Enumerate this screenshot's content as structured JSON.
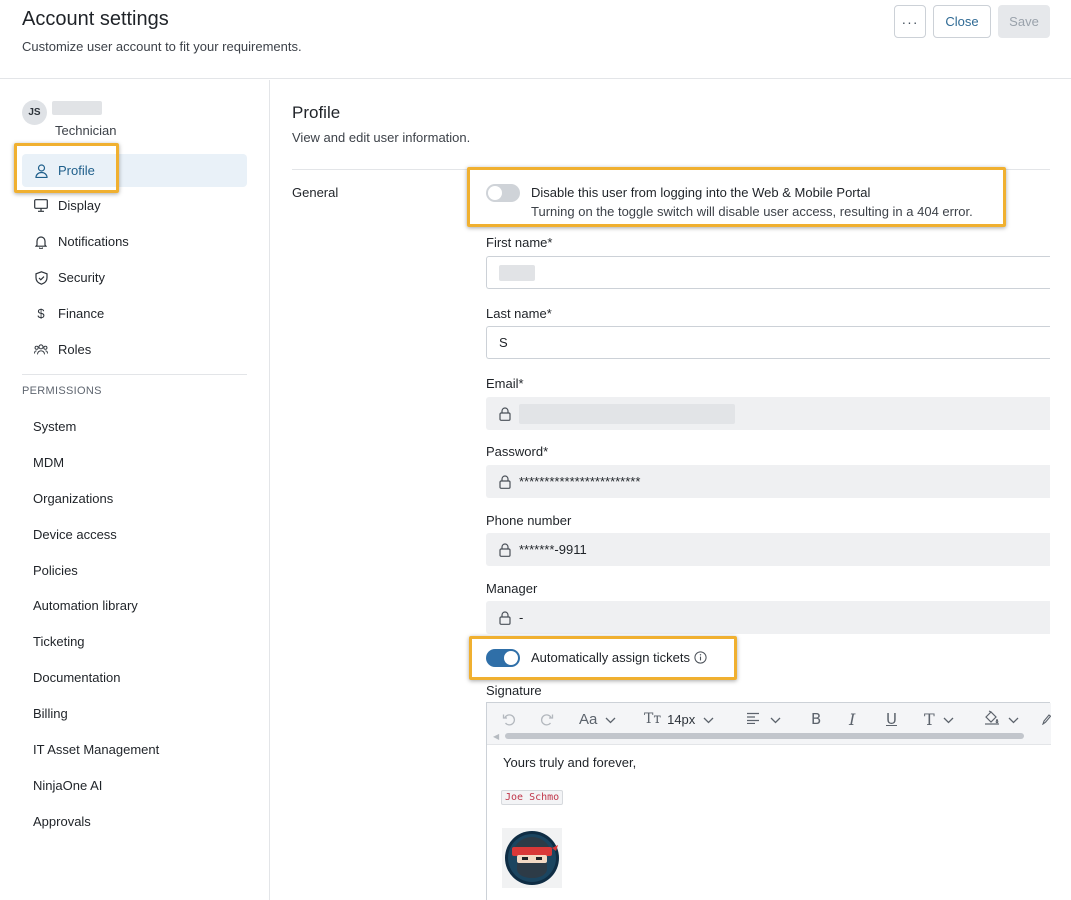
{
  "header": {
    "title": "Account settings",
    "subtitle": "Customize user account to fit your requirements.",
    "more_label": "···",
    "close_label": "Close",
    "save_label": "Save"
  },
  "user": {
    "initials": "JS",
    "role": "Technician"
  },
  "sidebar": {
    "items": [
      {
        "label": "Profile",
        "icon": "user-icon",
        "active": true
      },
      {
        "label": "Display",
        "icon": "monitor-icon"
      },
      {
        "label": "Notifications",
        "icon": "bell-icon"
      },
      {
        "label": "Security",
        "icon": "shield-icon"
      },
      {
        "label": "Finance",
        "icon": "dollar-icon"
      },
      {
        "label": "Roles",
        "icon": "users-icon"
      }
    ],
    "permissions_heading": "PERMISSIONS",
    "permissions": [
      "System",
      "MDM",
      "Organizations",
      "Device access",
      "Policies",
      "Automation library",
      "Ticketing",
      "Documentation",
      "Billing",
      "IT Asset Management",
      "NinjaOne AI",
      "Approvals"
    ]
  },
  "profile": {
    "title": "Profile",
    "subtitle": "View and edit user information.",
    "group_label": "General",
    "disable_toggle": {
      "title": "Disable this user from logging into the Web & Mobile Portal",
      "description": "Turning on the toggle switch will disable user access, resulting in a 404 error.",
      "on": false
    },
    "fields": {
      "first_name_label": "First name*",
      "last_name_label": "Last name*",
      "last_name_value": "S",
      "email_label": "Email*",
      "password_label": "Password*",
      "password_value": "************************",
      "phone_label": "Phone number",
      "phone_value": "*******-9911",
      "manager_label": "Manager",
      "manager_value": "-"
    },
    "auto_assign": {
      "label": "Automatically assign tickets",
      "on": true
    },
    "signature": {
      "label": "Signature",
      "font_size": "14px",
      "font_label": "Aa",
      "text": "Yours truly and forever,",
      "code_name": "Joe Schmo"
    }
  },
  "colors": {
    "accent": "#2f6fa8",
    "highlight": "#f0b030",
    "active_bg": "#e9f1f8"
  }
}
